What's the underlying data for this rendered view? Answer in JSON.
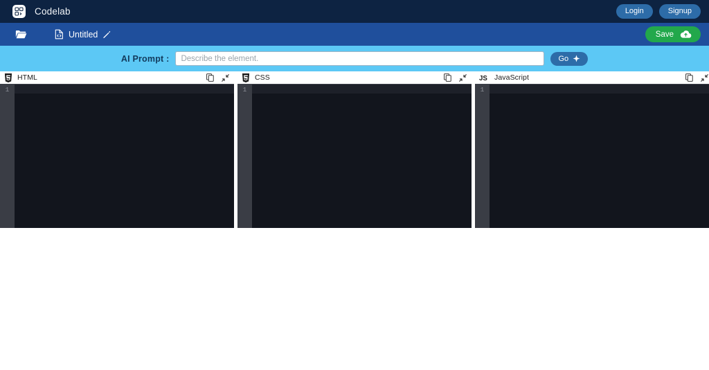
{
  "app": {
    "brand_name": "Codelab",
    "logo_icon": "codelab-logo-icon"
  },
  "topbar": {
    "login_label": "Login",
    "signup_label": "Signup",
    "background_color": "#0d2342",
    "button_color": "#2d6ca8"
  },
  "filebar": {
    "folder_icon": "folder-open-icon",
    "file_icon": "file-code-icon",
    "file_name": "Untitled",
    "edit_icon": "pencil-icon",
    "save_label": "Save",
    "save_icon": "cloud-upload-icon",
    "background_color": "#1f4f9c",
    "save_color": "#22a84b"
  },
  "prompt": {
    "label": "AI Prompt :",
    "placeholder": "Describe the element.",
    "value": "",
    "go_label": "Go",
    "go_icon": "sparkle-icon",
    "background_color": "#5cc8f5"
  },
  "editors": [
    {
      "id": "html",
      "title": "HTML",
      "icon": "html5-icon",
      "icon_color": "#1b1b1b",
      "copy_icon": "copy-icon",
      "collapse_icon": "shrink-arrows-icon",
      "line_numbers": [
        "1"
      ],
      "code": ""
    },
    {
      "id": "css",
      "title": "CSS",
      "icon": "css3-icon",
      "icon_color": "#1b1b1b",
      "copy_icon": "copy-icon",
      "collapse_icon": "shrink-arrows-icon",
      "line_numbers": [
        "1"
      ],
      "code": ""
    },
    {
      "id": "javascript",
      "title": "JavaScript",
      "icon": "js-icon",
      "icon_color": "#1b1b1b",
      "copy_icon": "copy-icon",
      "collapse_icon": "shrink-arrows-icon",
      "line_numbers": [
        "1"
      ],
      "code": ""
    }
  ]
}
